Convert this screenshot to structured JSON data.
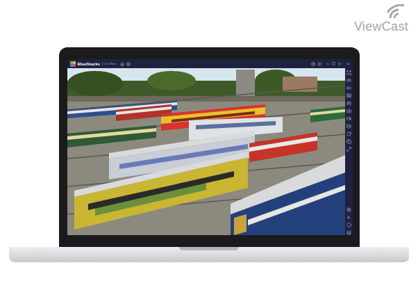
{
  "logo": {
    "text": "ViewCast"
  },
  "window": {
    "title": "BlueStacks",
    "version": "5.10.0 Beta"
  }
}
